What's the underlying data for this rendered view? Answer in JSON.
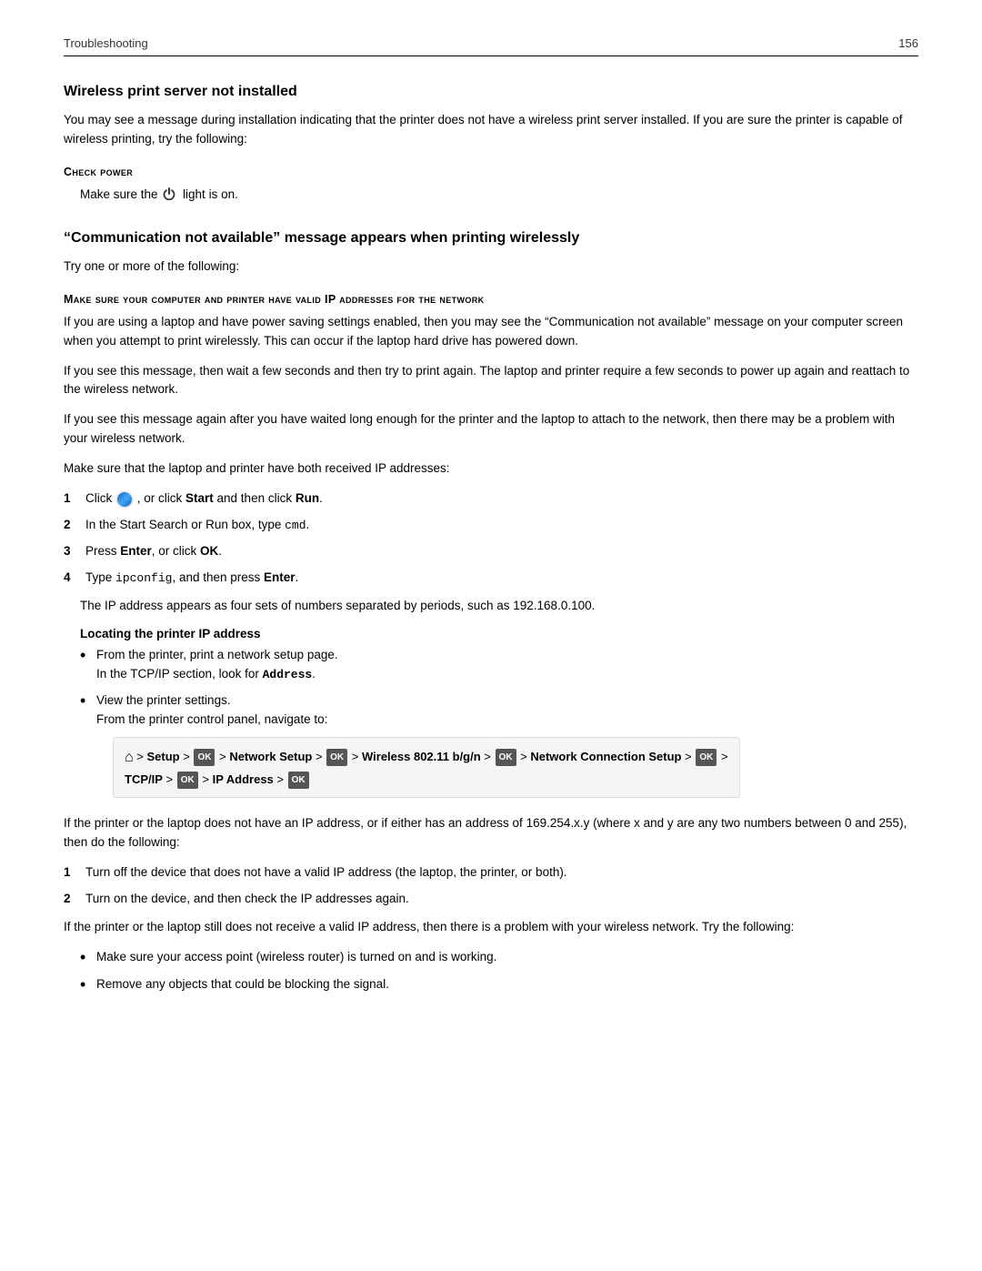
{
  "header": {
    "left": "Troubleshooting",
    "right": "156"
  },
  "section1": {
    "title": "Wireless print server not installed",
    "intro": "You may see a message during installation indicating that the printer does not have a wireless print server installed. If you are sure the printer is capable of wireless printing, try the following:",
    "check_power_heading": "Check power",
    "check_power_text": "Make sure the  light is on."
  },
  "section2": {
    "title": "“Communication not available” message appears when printing wirelessly",
    "intro": "Try one or more of the following:",
    "make_sure_heading": "Make sure your computer and printer have valid IP addresses for the network",
    "paragraphs": [
      "If you are using a laptop and have power saving settings enabled, then you may see the “Communication not available” message on your computer screen when you attempt to print wirelessly. This can occur if the laptop hard drive has powered down.",
      "If you see this message, then wait a few seconds and then try to print again. The laptop and printer require a few seconds to power up again and reattach to the wireless network.",
      "If you see this message again after you have waited long enough for the printer and the laptop to attach to the network, then there may be a problem with your wireless network.",
      "Make sure that the laptop and printer have both received IP addresses:"
    ],
    "steps": [
      {
        "num": "1",
        "parts": [
          {
            "type": "text",
            "content": "Click "
          },
          {
            "type": "icon",
            "content": "windows-icon"
          },
          {
            "type": "text",
            "content": ", or click "
          },
          {
            "type": "bold",
            "content": "Start"
          },
          {
            "type": "text",
            "content": " and then click "
          },
          {
            "type": "bold",
            "content": "Run"
          },
          {
            "type": "text",
            "content": "."
          }
        ]
      },
      {
        "num": "2",
        "parts": [
          {
            "type": "text",
            "content": "In the Start Search or Run box, type "
          },
          {
            "type": "code",
            "content": "cmd"
          },
          {
            "type": "text",
            "content": "."
          }
        ]
      },
      {
        "num": "3",
        "parts": [
          {
            "type": "text",
            "content": "Press "
          },
          {
            "type": "bold",
            "content": "Enter"
          },
          {
            "type": "text",
            "content": ", or click "
          },
          {
            "type": "bold",
            "content": "OK"
          },
          {
            "type": "text",
            "content": "."
          }
        ]
      },
      {
        "num": "4",
        "parts": [
          {
            "type": "text",
            "content": "Type "
          },
          {
            "type": "code",
            "content": "ipconfig"
          },
          {
            "type": "text",
            "content": ", and then press "
          },
          {
            "type": "bold",
            "content": "Enter"
          },
          {
            "type": "text",
            "content": "."
          }
        ]
      }
    ],
    "step4_sub": "The IP address appears as four sets of numbers separated by periods, such as 192.168.0.100.",
    "locating_heading": "Locating the printer IP address",
    "locating_bullets": [
      {
        "main": "From the printer, print a network setup page.",
        "sub": "In the TCP/IP section, look for Address."
      },
      {
        "main": "View the printer settings.",
        "sub_nav": true
      }
    ],
    "nav_path": {
      "home_symbol": "⌂",
      "parts": [
        "> Setup >",
        "OK",
        "> Network Setup >",
        "OK",
        "> Wireless 802.11 b/g/n >",
        "OK",
        "> Network Connection Setup >",
        "OK",
        ">"
      ],
      "line2_parts": [
        "TCP/IP >",
        "OK",
        "> IP Address >",
        "OK"
      ]
    },
    "if_no_ip_text": "If the printer or the laptop does not have an IP address, or if either has an address of 169.254.x.y (where x and y are any two numbers between 0 and 255), then do the following:",
    "ip_steps": [
      {
        "num": "1",
        "text": "Turn off the device that does not have a valid IP address (the laptop, the printer, or both)."
      },
      {
        "num": "2",
        "text": "Turn on the device, and then check the IP addresses again."
      }
    ],
    "still_no_ip_text": "If the printer or the laptop still does not receive a valid IP address, then there is a problem with your wireless network. Try the following:",
    "final_bullets": [
      "Make sure your access point (wireless router) is turned on and is working.",
      "Remove any objects that could be blocking the signal."
    ]
  }
}
